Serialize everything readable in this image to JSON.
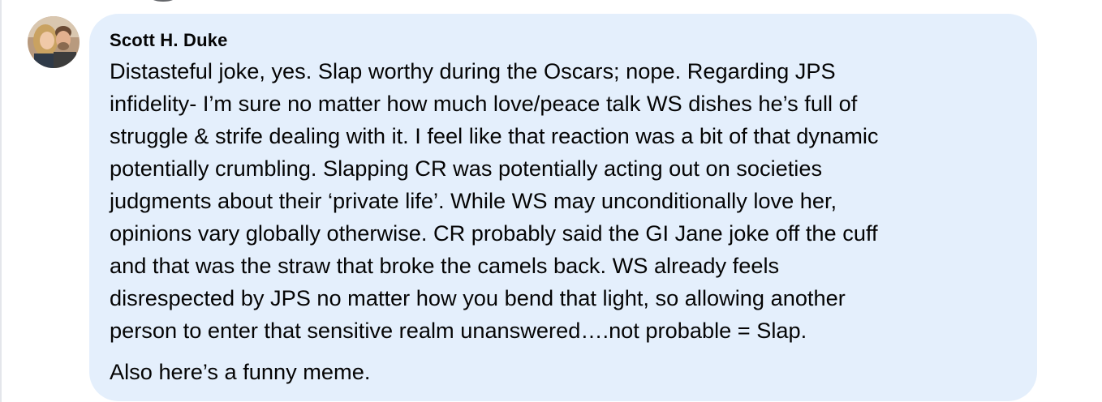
{
  "comment": {
    "author": "Scott H. Duke",
    "avatar_icon": "profile-photo",
    "paragraph_1_lines": [
      "Distasteful joke, yes. Slap worthy during the Oscars; nope. Regarding JPS",
      "infidelity- I’m sure no matter how much love/peace talk WS dishes he’s full of",
      "struggle & strife dealing with it. I feel like that reaction was a bit of that dynamic",
      "potentially crumbling. Slapping CR was potentially acting out on societies",
      "judgments about their ‘private life’. While WS may unconditionally love her,",
      "opinions vary globally otherwise. CR probably said the GI Jane joke off the cuff",
      "and that was the straw that broke the camels back. WS already feels",
      "disrespected by JPS no matter how you bend that light, so allowing another",
      "person to enter that sensitive realm unanswered….not probable = Slap."
    ],
    "paragraph_2": "Also here’s a funny meme."
  },
  "colors": {
    "bubble_background": "#e4effc",
    "text": "#050505"
  }
}
